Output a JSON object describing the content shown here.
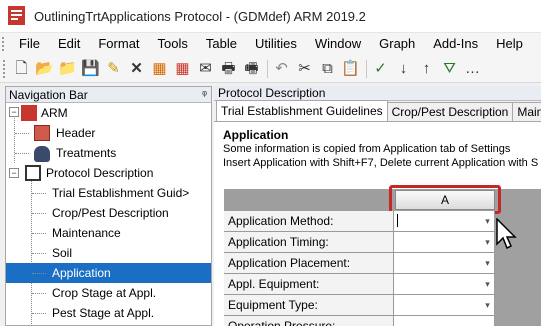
{
  "window": {
    "title": "OutliningTrtApplications Protocol - (GDMdef) ARM 2019.2"
  },
  "menu": [
    "File",
    "Edit",
    "Format",
    "Tools",
    "Table",
    "Utilities",
    "Window",
    "Graph",
    "Add-Ins",
    "Help"
  ],
  "toolbar": {
    "icons": [
      "new-document-icon",
      "open-folder-icon",
      "open-file-icon",
      "save-icon",
      "edit-icon",
      "delete-icon",
      "bde-icon-1",
      "bde-icon-2",
      "email-icon",
      "print-icon",
      "print-preview-icon",
      "undo-icon",
      "cut-icon",
      "copy-icon",
      "paste-icon",
      "spellcheck-icon",
      "sort-ascending-icon",
      "sort-descending-icon",
      "filter-icon",
      "more-icon"
    ],
    "glyphs": [
      "🗋",
      "📂",
      "📁",
      "💾",
      "✎",
      "✕",
      "▦",
      "▦",
      "✉",
      "🖶",
      "🖷",
      "↶",
      "✂",
      "⧉",
      "📋",
      "✓",
      "↓",
      "↑",
      "⛛",
      "…"
    ]
  },
  "nav": {
    "header": "Navigation Bar",
    "pin": "ᵠ",
    "items": [
      {
        "label": "ARM"
      },
      {
        "label": "Header"
      },
      {
        "label": "Treatments"
      },
      {
        "label": "Protocol Description"
      },
      {
        "label": "Trial Establishment Guid>"
      },
      {
        "label": "Crop/Pest Description"
      },
      {
        "label": "Maintenance"
      },
      {
        "label": "Soil"
      },
      {
        "label": "Application"
      },
      {
        "label": "Crop Stage at Appl."
      },
      {
        "label": "Pest Stage at Appl."
      }
    ]
  },
  "content": {
    "header": "Protocol Description",
    "tabs": [
      "Trial Establishment Guidelines",
      "Crop/Pest Description",
      "Mainte"
    ],
    "section_title": "Application",
    "info_lines": [
      "Some information is copied from Application tab of Settings",
      "Insert Application with Shift+F7, Delete current Application with S"
    ],
    "grid": {
      "column": "A",
      "rows": [
        "Application Method:",
        "Application Timing:",
        "Application Placement:",
        "Appl. Equipment:",
        "Equipment Type:",
        "Operation Pressure:"
      ]
    }
  },
  "colors": {
    "selection": "#1a6fc4",
    "highlight_box": "#c62828"
  }
}
